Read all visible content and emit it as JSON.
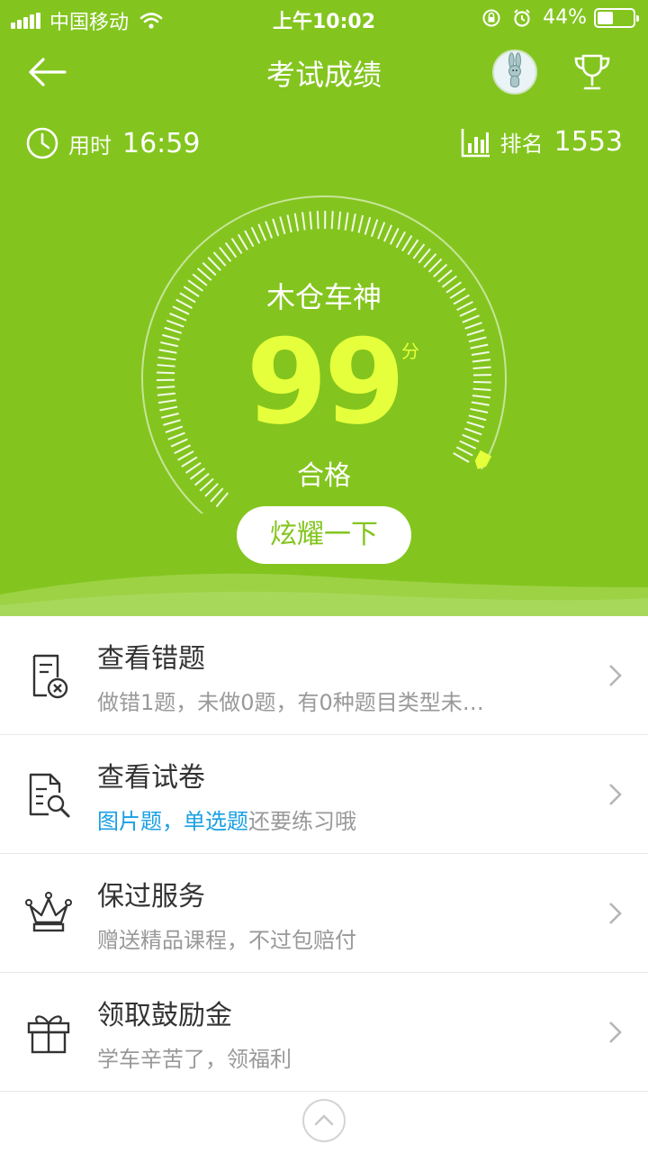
{
  "status_bar": {
    "carrier": "中国移动",
    "time": "上午10:02",
    "battery": "44%",
    "battery_level": 0.44
  },
  "header": {
    "title": "考试成绩"
  },
  "stats": {
    "time_label": "用时",
    "time_value": "16:59",
    "rank_label": "排名",
    "rank_value": "1553"
  },
  "result": {
    "rank_title": "木仓车神",
    "score": "99",
    "unit": "分",
    "status": "合格",
    "score_fraction": 0.99,
    "share_button": "炫耀一下"
  },
  "menu": [
    {
      "title": "查看错题",
      "subtitle": "做错1题，未做0题，有0种题目类型未…",
      "icon": "wrong-answers-icon"
    },
    {
      "title": "查看试卷",
      "highlight": "图片题，单选题",
      "subtitle_rest": "还要练习哦",
      "icon": "paper-search-icon"
    },
    {
      "title": "保过服务",
      "subtitle": "赠送精品课程，不过包赔付",
      "icon": "crown-icon"
    },
    {
      "title": "领取鼓励金",
      "subtitle": "学车辛苦了，领福利",
      "icon": "gift-icon"
    }
  ],
  "colors": {
    "primary_green": "#83c51e",
    "score_yellow": "#e6ff3c",
    "highlight_blue": "#1aa0e3"
  }
}
